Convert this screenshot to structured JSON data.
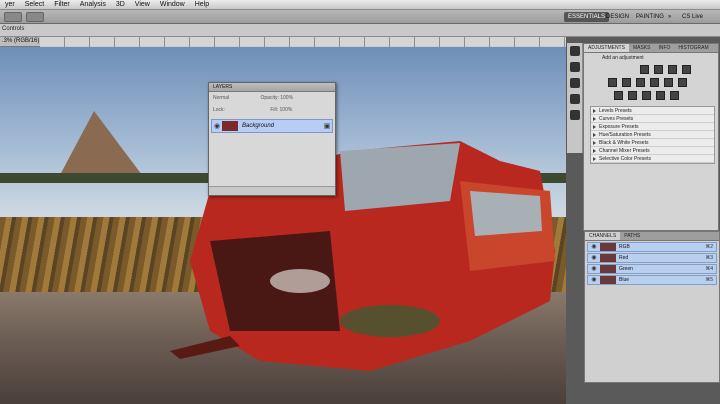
{
  "menu": [
    "yer",
    "Select",
    "Filter",
    "Analysis",
    "3D",
    "View",
    "Window",
    "Help"
  ],
  "workspaces": {
    "essentials": "ESSENTIALS",
    "design": "DESIGN",
    "painting": "PAINTING",
    "more": "»"
  },
  "cslive": "CS Live",
  "options": {
    "text": "Controls"
  },
  "doc": {
    "tab": ".3% (RGB/16)"
  },
  "layers": {
    "title": "LAYERS",
    "blend": "Normal",
    "opacity_label": "Opacity:",
    "opacity_value": "100%",
    "lock_label": "Lock:",
    "fill_label": "Fill:",
    "fill_value": "100%",
    "layer_name": "Background"
  },
  "adjustments": {
    "tabs": [
      "ADJUSTMENTS",
      "MASKS",
      "INFO",
      "HISTOGRAM"
    ],
    "title": "Add an adjustment",
    "presets": [
      "Levels Presets",
      "Curves Presets",
      "Exposure Presets",
      "Hue/Saturation Presets",
      "Black & White Presets",
      "Channel Mixer Presets",
      "Selective Color Presets"
    ]
  },
  "channels": {
    "tabs": [
      "CHANNELS",
      "PATHS"
    ],
    "items": [
      {
        "name": "RGB",
        "key": "⌘2"
      },
      {
        "name": "Red",
        "key": "⌘3"
      },
      {
        "name": "Green",
        "key": "⌘4"
      },
      {
        "name": "Blue",
        "key": "⌘5"
      }
    ]
  },
  "colors": {
    "accent": "#b8cff0",
    "panel_bg": "#d4d4d4"
  }
}
